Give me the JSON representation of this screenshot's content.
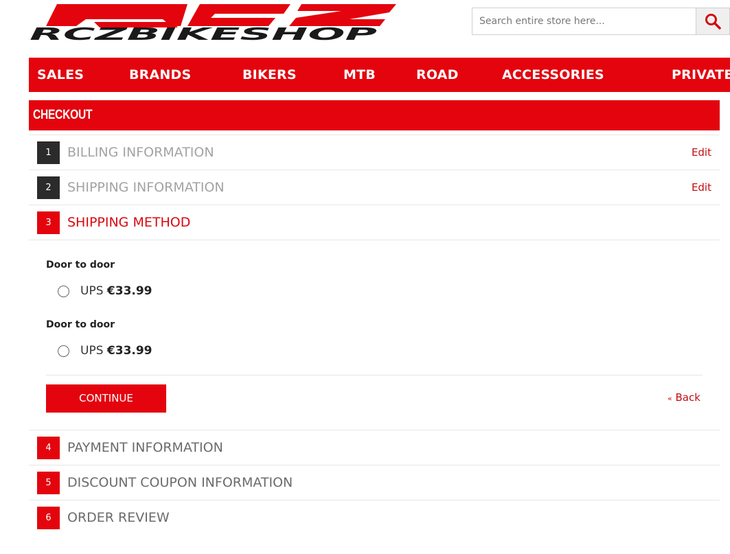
{
  "header": {
    "logo_text": "RCZBIKESHOP",
    "logo_mark": "RCZ",
    "search": {
      "placeholder": "Search entire store here..."
    }
  },
  "nav": {
    "items": [
      "SALES",
      "BRANDS",
      "BIKERS",
      "MTB",
      "ROAD",
      "ACCESSORIES",
      "PRIVATE"
    ]
  },
  "checkout": {
    "title": "CHECKOUT",
    "steps": [
      {
        "number": "1",
        "title": "BILLING INFORMATION",
        "edit": "Edit"
      },
      {
        "number": "2",
        "title": "SHIPPING INFORMATION",
        "edit": "Edit"
      },
      {
        "number": "3",
        "title": "SHIPPING METHOD"
      },
      {
        "number": "4",
        "title": "PAYMENT INFORMATION"
      },
      {
        "number": "5",
        "title": "DISCOUNT COUPON INFORMATION"
      },
      {
        "number": "6",
        "title": "ORDER REVIEW"
      }
    ],
    "shipping_methods": [
      {
        "group": "Door to door",
        "carrier": "UPS",
        "price": "€33.99"
      },
      {
        "group": "Door to door",
        "carrier": "UPS",
        "price": "€33.99"
      }
    ],
    "continue_label": "CONTINUE",
    "back_label": "Back",
    "back_prefix": "«"
  },
  "colors": {
    "brand_red": "#e3040e",
    "dark_step": "#2b2b2b",
    "link_red": "#c40d12"
  },
  "icons": {
    "search_button": "search-icon"
  }
}
